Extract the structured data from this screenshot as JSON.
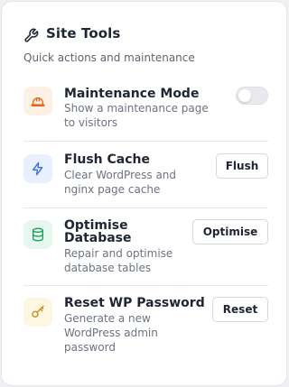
{
  "header": {
    "title": "Site Tools",
    "subtitle": "Quick actions and maintenance",
    "icon": "wrench-icon"
  },
  "tools": [
    {
      "name": "Maintenance Mode",
      "description_lines": [
        "Show a maintenance page",
        "to visitors"
      ],
      "icon": "hard-hat-icon",
      "icon_bg": "#fdf1e6",
      "icon_color": "#e06a1b",
      "control": "toggle",
      "toggle_on": false
    },
    {
      "name": "Flush Cache",
      "description_lines": [
        "Clear WordPress and",
        "nginx page cache"
      ],
      "icon": "lightning-icon",
      "icon_bg": "#e9f0fd",
      "icon_color": "#3b6fd8",
      "control": "button",
      "button_label": "Flush"
    },
    {
      "name_lines": [
        "Optimise",
        "Database"
      ],
      "description_lines": [
        "Repair and optimise",
        "database tables"
      ],
      "icon": "database-icon",
      "icon_bg": "#e6f7ee",
      "icon_color": "#1f9a5a",
      "control": "button",
      "button_label": "Optimise"
    },
    {
      "name": "Reset WP Password",
      "description_lines": [
        "Generate a new",
        "WordPress admin",
        "password"
      ],
      "icon": "key-icon",
      "icon_bg": "#fdf6e3",
      "icon_color": "#c98a0c",
      "control": "button",
      "button_label": "Reset"
    }
  ]
}
